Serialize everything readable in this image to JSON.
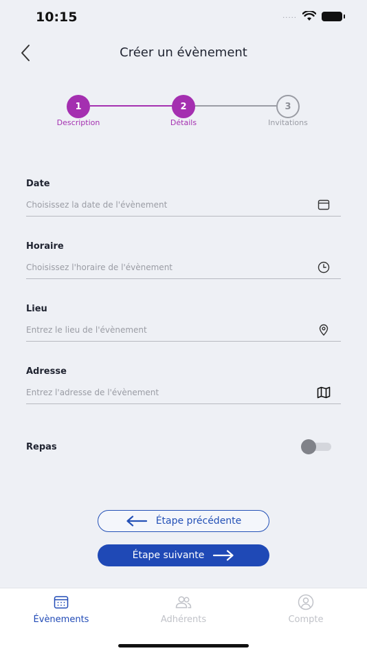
{
  "status_bar": {
    "time": "10:15",
    "signal": "....."
  },
  "header": {
    "title": "Créer un évènement"
  },
  "stepper": {
    "steps": [
      {
        "number": "1",
        "label": "Description",
        "state": "active"
      },
      {
        "number": "2",
        "label": "Détails",
        "state": "active"
      },
      {
        "number": "3",
        "label": "Invitations",
        "state": "inactive"
      }
    ]
  },
  "form": {
    "date": {
      "label": "Date",
      "placeholder": "Choisissez la date de l'évènement",
      "icon": "calendar-icon"
    },
    "horaire": {
      "label": "Horaire",
      "placeholder": "Choisissez l'horaire de l'évènement",
      "icon": "clock-icon"
    },
    "lieu": {
      "label": "Lieu",
      "placeholder": "Entrez le lieu de l'évènement",
      "icon": "location-pin-icon"
    },
    "adresse": {
      "label": "Adresse",
      "placeholder": "Entrez l'adresse de l'évènement",
      "icon": "map-icon"
    },
    "repas": {
      "label": "Repas",
      "enabled": false
    }
  },
  "buttons": {
    "previous": "Étape précédente",
    "next": "Étape suivante"
  },
  "tab_bar": {
    "tabs": [
      {
        "label": "Évènements",
        "icon": "calendar-icon",
        "active": true
      },
      {
        "label": "Adhérents",
        "icon": "users-icon",
        "active": false
      },
      {
        "label": "Compte",
        "icon": "account-icon",
        "active": false
      }
    ]
  },
  "colors": {
    "accent_purple": "#a42fb0",
    "primary_blue": "#1f49b6",
    "background": "#eef0f5"
  }
}
